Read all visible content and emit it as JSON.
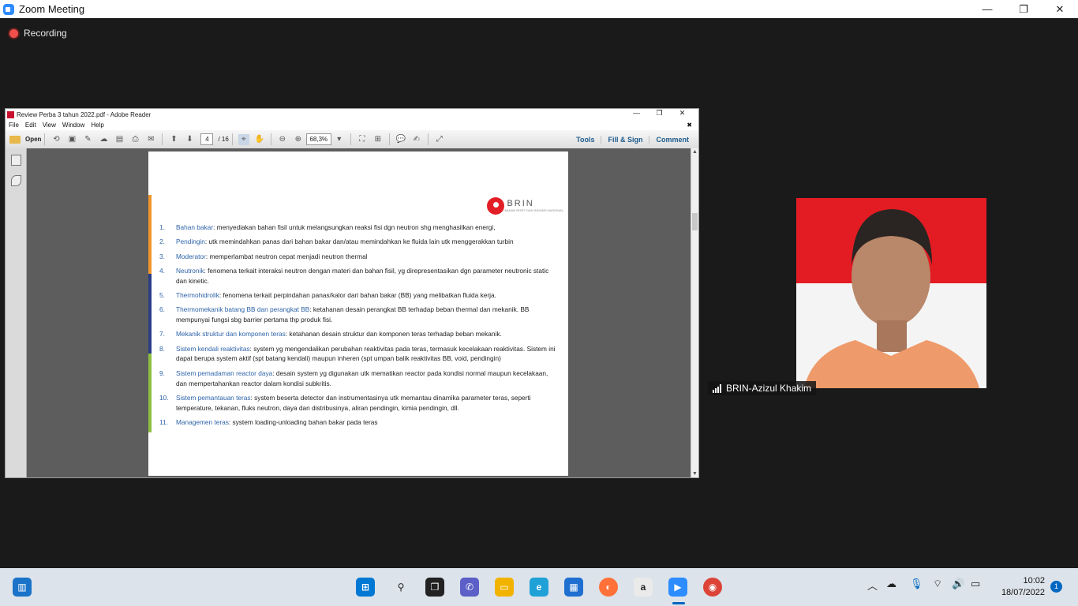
{
  "zoom": {
    "title": "Zoom Meeting",
    "recording_label": "Recording",
    "controls": {
      "minimize": "—",
      "maximize": "❐",
      "close": "✕"
    }
  },
  "adobe": {
    "title": "Review Perba 3 tahun 2022.pdf - Adobe Reader",
    "menu": [
      "File",
      "Edit",
      "View",
      "Window",
      "Help"
    ],
    "open_label": "Open",
    "page_current": "4",
    "page_total": "/ 16",
    "zoom_level": "68,3%",
    "right_tools": [
      "Tools",
      "Fill & Sign",
      "Comment"
    ]
  },
  "document": {
    "logo_text": "BRIN",
    "logo_subtext": "BADAN RISET DAN INOVASI NASIONAL",
    "items": [
      {
        "num": "1.",
        "term": "Bahan bakar",
        "text": ": menyediakan bahan fisil untuk melangsungkan reaksi fisi dgn neutron shg menghasilkan energi,"
      },
      {
        "num": "2.",
        "term": "Pendingin",
        "text": ": utk memindahkan panas dari bahan bakar dan/atau memindahkan ke fluida lain utk menggerakkan turbin"
      },
      {
        "num": "3.",
        "term": "Moderator",
        "text": ": memperlambat neutron cepat menjadi neutron thermal"
      },
      {
        "num": "4.",
        "term": "Neutronik",
        "text": ": fenomena terkait interaksi neutron dengan materi dan bahan fisil, yg direpresentasikan dgn parameter neutronic static dan kinetic."
      },
      {
        "num": "5.",
        "term": "Thermohidrolik",
        "text": ": fenomena terkait perpindahan panas/kalor dari bahan bakar (BB) yang melibatkan fluida kerja."
      },
      {
        "num": "6.",
        "term": "Thermomekanik batang BB dan perangkat BB",
        "text": ": ketahanan desain perangkat BB terhadap beban thermal dan mekanik. BB mempunyai fungsi sbg barrier pertama thp produk fisi."
      },
      {
        "num": "7.",
        "term": "Mekanik struktur dan komponen teras",
        "text": ": ketahanan desain struktur dan komponen teras terhadap beban mekanik."
      },
      {
        "num": "8.",
        "term": "Sistem kendali reaktivitas",
        "text": ": system yg mengendalikan perubahan reaktivitas pada teras, termasuk kecelakaan reaktivitas. Sistem ini dapat berupa system aktif (spt batang kendali) maupun inheren (spt umpan balik reaktivitas BB, void, pendingin)"
      },
      {
        "num": "9.",
        "term": "Sistem pemadaman reactor daya",
        "text": ": desain system yg digunakan utk mematikan reactor pada kondisi normal maupun kecelakaan, dan mempertahankan reactor dalam kondisi subkritis."
      },
      {
        "num": "10.",
        "term": "Sistem pemantauan teras",
        "text": ": system beserta detector dan instrumentasinya utk memantau dinamika parameter teras, seperti temperature, tekanan, fluks neutron, daya dan distribusinya, aliran pendingin, kimia pendingin, dll."
      },
      {
        "num": "11.",
        "term": "Managemen teras",
        "text": ": system loading-unloading bahan bakar pada teras"
      }
    ],
    "bar_colors": [
      "#f0962a",
      "#2a3c86",
      "#8cbf3f"
    ]
  },
  "participant": {
    "name": "BRIN-Azizul Khakim"
  },
  "taskbar": {
    "time": "10:02",
    "date": "18/07/2022",
    "notification_count": "1"
  }
}
